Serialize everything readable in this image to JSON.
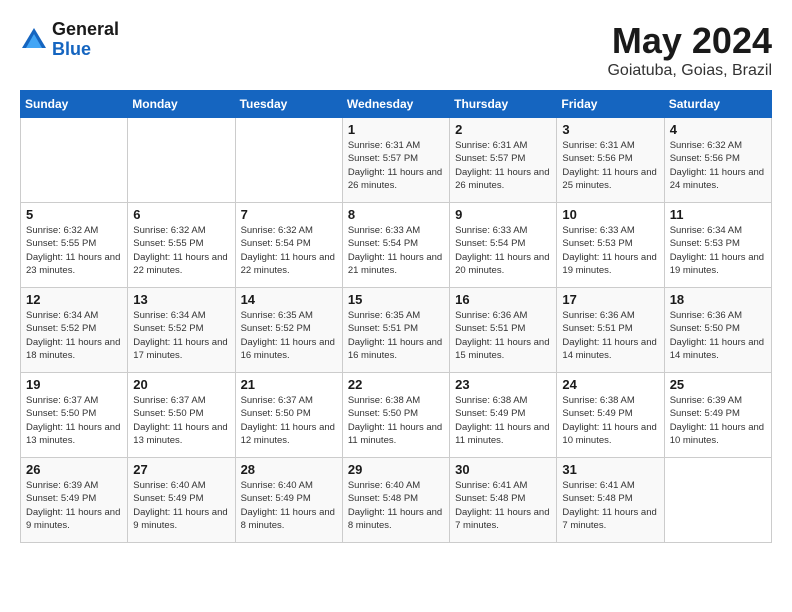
{
  "logo": {
    "general": "General",
    "blue": "Blue"
  },
  "title": {
    "month_year": "May 2024",
    "location": "Goiatuba, Goias, Brazil"
  },
  "weekdays": [
    "Sunday",
    "Monday",
    "Tuesday",
    "Wednesday",
    "Thursday",
    "Friday",
    "Saturday"
  ],
  "weeks": [
    [
      {
        "day": "",
        "info": ""
      },
      {
        "day": "",
        "info": ""
      },
      {
        "day": "",
        "info": ""
      },
      {
        "day": "1",
        "info": "Sunrise: 6:31 AM\nSunset: 5:57 PM\nDaylight: 11 hours\nand 26 minutes."
      },
      {
        "day": "2",
        "info": "Sunrise: 6:31 AM\nSunset: 5:57 PM\nDaylight: 11 hours\nand 26 minutes."
      },
      {
        "day": "3",
        "info": "Sunrise: 6:31 AM\nSunset: 5:56 PM\nDaylight: 11 hours\nand 25 minutes."
      },
      {
        "day": "4",
        "info": "Sunrise: 6:32 AM\nSunset: 5:56 PM\nDaylight: 11 hours\nand 24 minutes."
      }
    ],
    [
      {
        "day": "5",
        "info": "Sunrise: 6:32 AM\nSunset: 5:55 PM\nDaylight: 11 hours\nand 23 minutes."
      },
      {
        "day": "6",
        "info": "Sunrise: 6:32 AM\nSunset: 5:55 PM\nDaylight: 11 hours\nand 22 minutes."
      },
      {
        "day": "7",
        "info": "Sunrise: 6:32 AM\nSunset: 5:54 PM\nDaylight: 11 hours\nand 22 minutes."
      },
      {
        "day": "8",
        "info": "Sunrise: 6:33 AM\nSunset: 5:54 PM\nDaylight: 11 hours\nand 21 minutes."
      },
      {
        "day": "9",
        "info": "Sunrise: 6:33 AM\nSunset: 5:54 PM\nDaylight: 11 hours\nand 20 minutes."
      },
      {
        "day": "10",
        "info": "Sunrise: 6:33 AM\nSunset: 5:53 PM\nDaylight: 11 hours\nand 19 minutes."
      },
      {
        "day": "11",
        "info": "Sunrise: 6:34 AM\nSunset: 5:53 PM\nDaylight: 11 hours\nand 19 minutes."
      }
    ],
    [
      {
        "day": "12",
        "info": "Sunrise: 6:34 AM\nSunset: 5:52 PM\nDaylight: 11 hours\nand 18 minutes."
      },
      {
        "day": "13",
        "info": "Sunrise: 6:34 AM\nSunset: 5:52 PM\nDaylight: 11 hours\nand 17 minutes."
      },
      {
        "day": "14",
        "info": "Sunrise: 6:35 AM\nSunset: 5:52 PM\nDaylight: 11 hours\nand 16 minutes."
      },
      {
        "day": "15",
        "info": "Sunrise: 6:35 AM\nSunset: 5:51 PM\nDaylight: 11 hours\nand 16 minutes."
      },
      {
        "day": "16",
        "info": "Sunrise: 6:36 AM\nSunset: 5:51 PM\nDaylight: 11 hours\nand 15 minutes."
      },
      {
        "day": "17",
        "info": "Sunrise: 6:36 AM\nSunset: 5:51 PM\nDaylight: 11 hours\nand 14 minutes."
      },
      {
        "day": "18",
        "info": "Sunrise: 6:36 AM\nSunset: 5:50 PM\nDaylight: 11 hours\nand 14 minutes."
      }
    ],
    [
      {
        "day": "19",
        "info": "Sunrise: 6:37 AM\nSunset: 5:50 PM\nDaylight: 11 hours\nand 13 minutes."
      },
      {
        "day": "20",
        "info": "Sunrise: 6:37 AM\nSunset: 5:50 PM\nDaylight: 11 hours\nand 13 minutes."
      },
      {
        "day": "21",
        "info": "Sunrise: 6:37 AM\nSunset: 5:50 PM\nDaylight: 11 hours\nand 12 minutes."
      },
      {
        "day": "22",
        "info": "Sunrise: 6:38 AM\nSunset: 5:50 PM\nDaylight: 11 hours\nand 11 minutes."
      },
      {
        "day": "23",
        "info": "Sunrise: 6:38 AM\nSunset: 5:49 PM\nDaylight: 11 hours\nand 11 minutes."
      },
      {
        "day": "24",
        "info": "Sunrise: 6:38 AM\nSunset: 5:49 PM\nDaylight: 11 hours\nand 10 minutes."
      },
      {
        "day": "25",
        "info": "Sunrise: 6:39 AM\nSunset: 5:49 PM\nDaylight: 11 hours\nand 10 minutes."
      }
    ],
    [
      {
        "day": "26",
        "info": "Sunrise: 6:39 AM\nSunset: 5:49 PM\nDaylight: 11 hours\nand 9 minutes."
      },
      {
        "day": "27",
        "info": "Sunrise: 6:40 AM\nSunset: 5:49 PM\nDaylight: 11 hours\nand 9 minutes."
      },
      {
        "day": "28",
        "info": "Sunrise: 6:40 AM\nSunset: 5:49 PM\nDaylight: 11 hours\nand 8 minutes."
      },
      {
        "day": "29",
        "info": "Sunrise: 6:40 AM\nSunset: 5:48 PM\nDaylight: 11 hours\nand 8 minutes."
      },
      {
        "day": "30",
        "info": "Sunrise: 6:41 AM\nSunset: 5:48 PM\nDaylight: 11 hours\nand 7 minutes."
      },
      {
        "day": "31",
        "info": "Sunrise: 6:41 AM\nSunset: 5:48 PM\nDaylight: 11 hours\nand 7 minutes."
      },
      {
        "day": "",
        "info": ""
      }
    ]
  ]
}
